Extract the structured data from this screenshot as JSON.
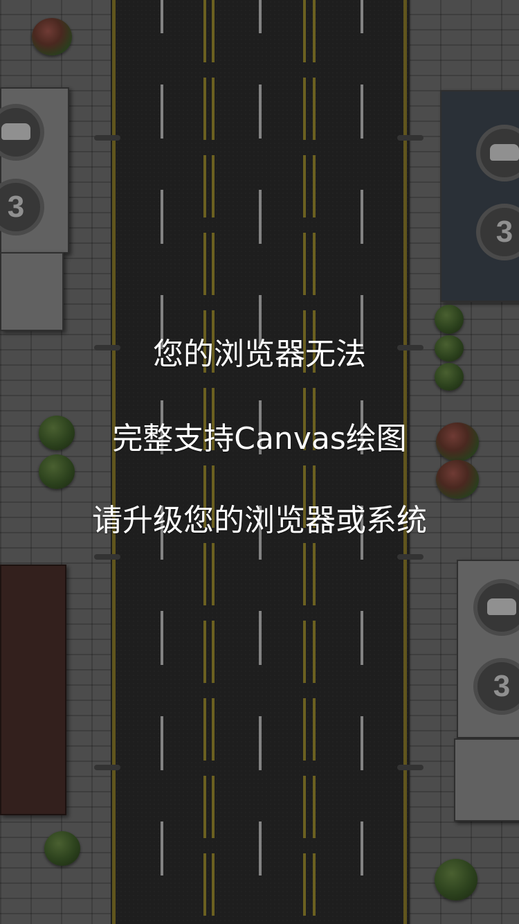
{
  "message": {
    "line1": "您的浏览器无法",
    "line2": "完整支持Canvas绘图",
    "line3": "请升级您的浏览器或系统"
  },
  "signs": {
    "level_number": "3"
  },
  "colors": {
    "road": "#2b2b2b",
    "sidewalk": "#6e6e6e",
    "lane_line": "#bcbcbc",
    "yellow_line": "#9a8a2e",
    "text": "#ffffff"
  }
}
